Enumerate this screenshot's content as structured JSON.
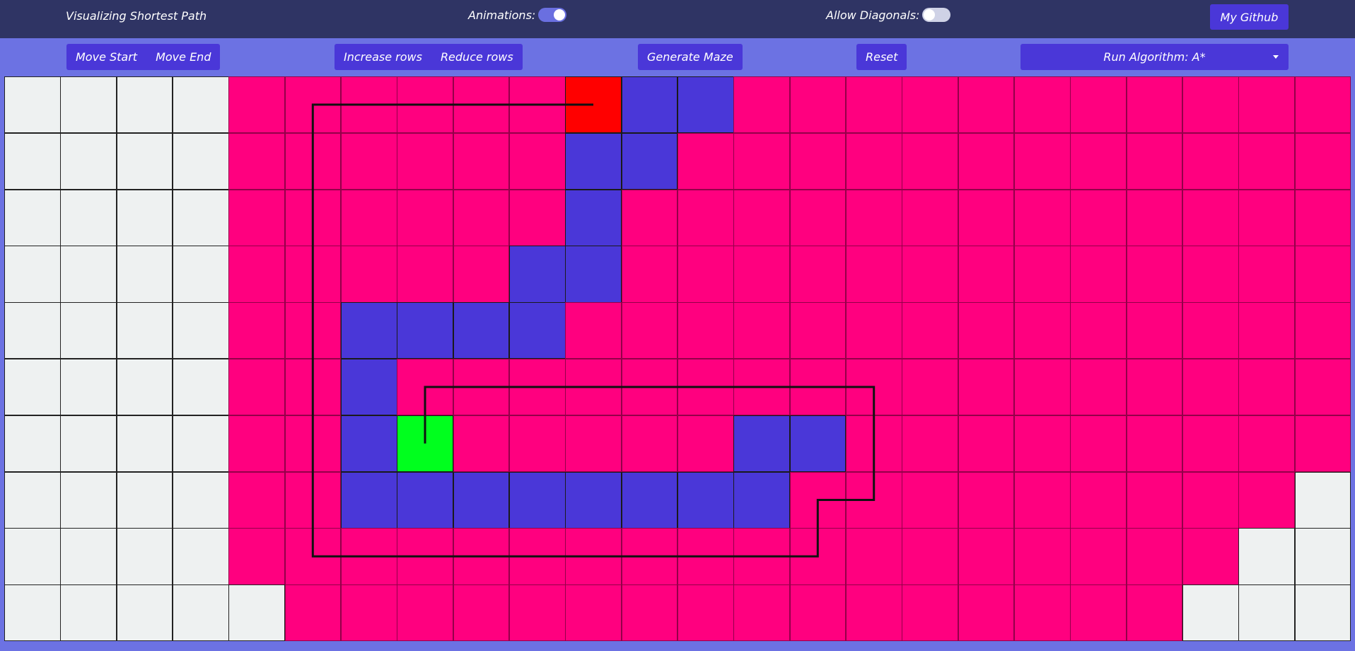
{
  "header": {
    "title": "Visualizing Shortest Path",
    "animations_label": "Animations:",
    "animations_on": true,
    "diagonals_label": "Allow Diagonals:",
    "diagonals_on": false,
    "github_label": "My Github"
  },
  "toolbar": {
    "move_start": "Move Start",
    "move_end": "Move End",
    "increase_rows": "Increase rows",
    "reduce_rows": "Reduce rows",
    "generate_maze": "Generate Maze",
    "reset": "Reset",
    "run_algorithm": "Run Algorithm: A*"
  },
  "colors": {
    "unvisited": "#eef1f1",
    "visited": "#ff007f",
    "wall": "#4a37d8",
    "start": "#00ff1e",
    "end": "#ff0000",
    "path": "#111111"
  },
  "grid": {
    "rows": 10,
    "cols": 24,
    "start": [
      6,
      7
    ],
    "end": [
      0,
      10
    ],
    "walls": [
      [
        0,
        11
      ],
      [
        0,
        12
      ],
      [
        1,
        10
      ],
      [
        1,
        11
      ],
      [
        2,
        10
      ],
      [
        3,
        9
      ],
      [
        3,
        10
      ],
      [
        4,
        6
      ],
      [
        4,
        7
      ],
      [
        4,
        8
      ],
      [
        4,
        9
      ],
      [
        5,
        6
      ],
      [
        6,
        6
      ],
      [
        6,
        13
      ],
      [
        6,
        14
      ],
      [
        7,
        6
      ],
      [
        7,
        7
      ],
      [
        7,
        8
      ],
      [
        7,
        9
      ],
      [
        7,
        10
      ],
      [
        7,
        11
      ],
      [
        7,
        12
      ],
      [
        7,
        13
      ]
    ],
    "unvisited": [
      [
        0,
        0
      ],
      [
        0,
        1
      ],
      [
        0,
        2
      ],
      [
        0,
        3
      ],
      [
        1,
        0
      ],
      [
        1,
        1
      ],
      [
        1,
        2
      ],
      [
        1,
        3
      ],
      [
        2,
        0
      ],
      [
        2,
        1
      ],
      [
        2,
        2
      ],
      [
        2,
        3
      ],
      [
        3,
        0
      ],
      [
        3,
        1
      ],
      [
        3,
        2
      ],
      [
        3,
        3
      ],
      [
        4,
        0
      ],
      [
        4,
        1
      ],
      [
        4,
        2
      ],
      [
        4,
        3
      ],
      [
        5,
        0
      ],
      [
        5,
        1
      ],
      [
        5,
        2
      ],
      [
        5,
        3
      ],
      [
        6,
        0
      ],
      [
        6,
        1
      ],
      [
        6,
        2
      ],
      [
        6,
        3
      ],
      [
        7,
        0
      ],
      [
        7,
        1
      ],
      [
        7,
        2
      ],
      [
        7,
        3
      ],
      [
        7,
        23
      ],
      [
        8,
        0
      ],
      [
        8,
        1
      ],
      [
        8,
        2
      ],
      [
        8,
        3
      ],
      [
        8,
        22
      ],
      [
        8,
        23
      ],
      [
        9,
        0
      ],
      [
        9,
        1
      ],
      [
        9,
        2
      ],
      [
        9,
        3
      ],
      [
        9,
        4
      ],
      [
        9,
        21
      ],
      [
        9,
        22
      ],
      [
        9,
        23
      ]
    ],
    "path": [
      [
        0,
        10
      ],
      [
        0,
        9
      ],
      [
        0,
        8
      ],
      [
        0,
        7
      ],
      [
        0,
        6
      ],
      [
        0,
        5
      ],
      [
        1,
        5
      ],
      [
        2,
        5
      ],
      [
        3,
        5
      ],
      [
        4,
        5
      ],
      [
        5,
        5
      ],
      [
        6,
        5
      ],
      [
        7,
        5
      ],
      [
        8,
        5
      ],
      [
        8,
        6
      ],
      [
        8,
        7
      ],
      [
        8,
        8
      ],
      [
        8,
        9
      ],
      [
        8,
        10
      ],
      [
        8,
        11
      ],
      [
        8,
        12
      ],
      [
        8,
        13
      ],
      [
        8,
        14
      ],
      [
        7,
        14
      ],
      [
        7,
        15
      ],
      [
        6,
        15
      ],
      [
        5,
        15
      ],
      [
        5,
        14
      ],
      [
        5,
        13
      ],
      [
        5,
        12
      ],
      [
        5,
        11
      ],
      [
        5,
        10
      ],
      [
        5,
        9
      ],
      [
        5,
        8
      ],
      [
        5,
        7
      ],
      [
        6,
        7
      ]
    ]
  }
}
